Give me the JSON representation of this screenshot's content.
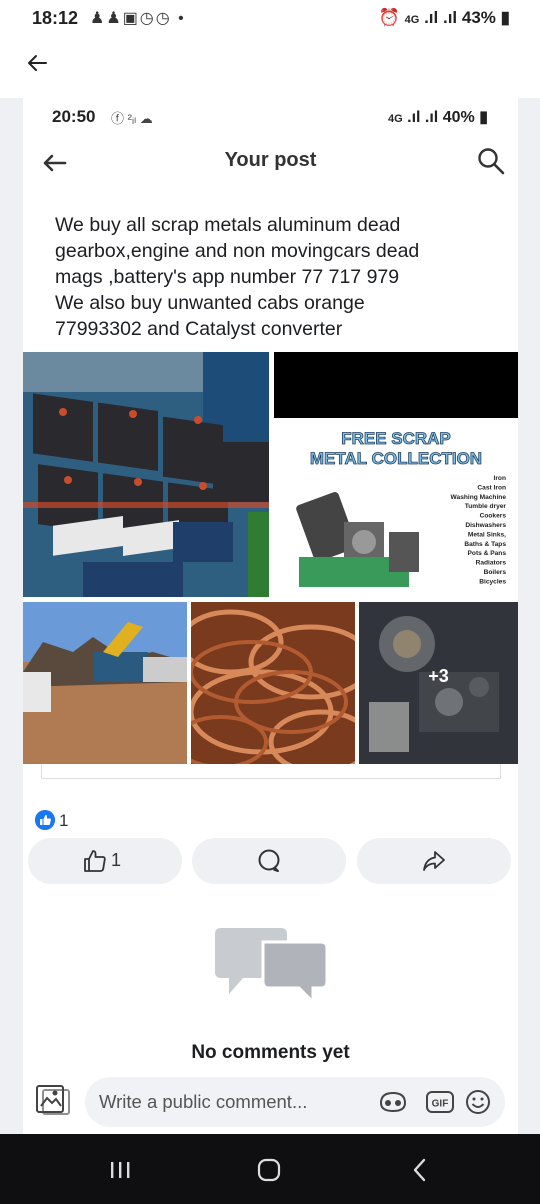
{
  "outer_status": {
    "time": "18:12",
    "network": "4G",
    "battery": "43%"
  },
  "inner_status": {
    "time": "20:50",
    "network": "4G",
    "battery": "40%"
  },
  "header": {
    "title": "Your post"
  },
  "post": {
    "text": "We buy all scrap metals aluminum dead\ngearbox,engine and  non movingcars dead\nmags ,battery's app number 77 717 979\nWe also buy unwanted cabs orange\n77993302 and Catalyst converter",
    "flyer": {
      "title_line1": "FREE SCRAP",
      "title_line2": "METAL COLLECTION",
      "items": [
        "Iron",
        "Cast Iron",
        "Washing Machine",
        "Tumble dryer",
        "Cookers",
        "Dishwashers",
        "Metal Sinks,",
        "Baths & Taps",
        "Pots & Pans",
        "Radiators",
        "Boilers",
        "Bicycles"
      ]
    },
    "more_photos": "+3"
  },
  "reactions": {
    "count": "1"
  },
  "actions": {
    "like_count": "1"
  },
  "comments": {
    "empty_text": "No comments yet",
    "placeholder": "Write a public comment..."
  },
  "colors": {
    "facebook_blue": "#1877f2",
    "button_bg": "#eef0f3",
    "nav_bar": "#0f0f12"
  }
}
